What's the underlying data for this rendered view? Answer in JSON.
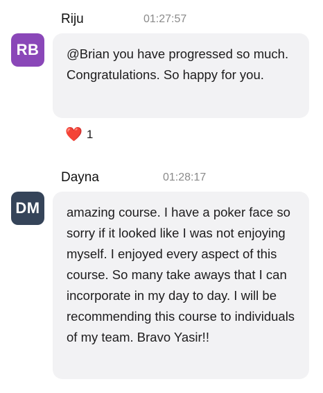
{
  "messages": [
    {
      "avatar_initials": "RB",
      "avatar_color": "#8a47b8",
      "name": "Riju",
      "time": "01:27:57",
      "text": "@Brian you have progressed so much. Congratulations. So happy for you.",
      "reaction": {
        "emoji": "❤️",
        "count": "1"
      }
    },
    {
      "avatar_initials": "DM",
      "avatar_color": "#354459",
      "name": "Dayna",
      "time": "01:28:17",
      "text": "amazing course. I have a poker face so sorry if it looked like I was not enjoying myself. I enjoyed every aspect of this course.  So many take aways that I can incorporate in my day to day. I will be recommending this course to individuals of my team. Bravo Yasir!!"
    }
  ]
}
